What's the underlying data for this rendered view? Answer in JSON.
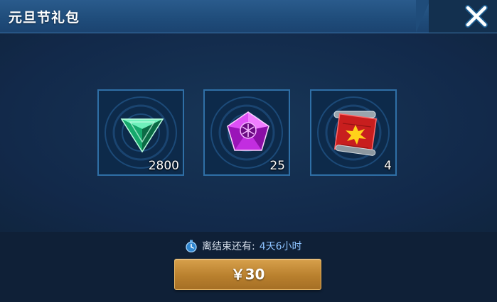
{
  "dialog": {
    "title": "元旦节礼包",
    "close_icon": "close-icon"
  },
  "items": [
    {
      "icon": "green-triangle-gem-icon",
      "count": "2800"
    },
    {
      "icon": "purple-pentagon-gem-icon",
      "count": "25"
    },
    {
      "icon": "red-scroll-icon",
      "count": "4"
    }
  ],
  "timer": {
    "icon": "stopwatch-icon",
    "label": "离结束还有:",
    "value": "4天6小时"
  },
  "buy_button": {
    "label": "￥30"
  },
  "colors": {
    "header": "#1f4c7a",
    "slot_border": "#2f6fa6",
    "button": "#b9802e",
    "timer_value": "#8ec3ff"
  }
}
